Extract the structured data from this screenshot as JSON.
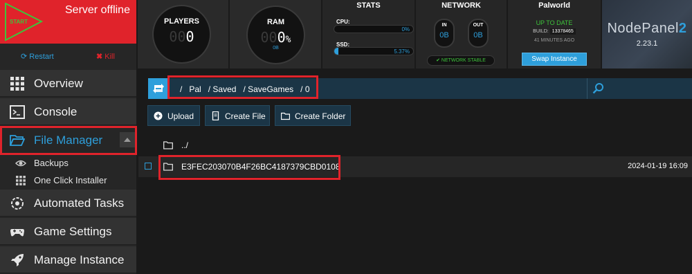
{
  "server": {
    "start_label": "START",
    "status": "Server offline",
    "restart_label": "Restart",
    "kill_label": "Kill"
  },
  "gauges": {
    "players": {
      "title": "PLAYERS",
      "dim": "00",
      "value": "0"
    },
    "ram": {
      "title": "RAM",
      "dim": "00",
      "value": "0",
      "unit": "%",
      "sub": "0B"
    }
  },
  "stats": {
    "title": "STATS",
    "cpu": {
      "label": "CPU:",
      "value": "0%",
      "fill_pct": 0
    },
    "ssd": {
      "label": "SSD:",
      "value": "5.37%",
      "fill_pct": 5.37
    }
  },
  "network": {
    "title": "NETWORK",
    "in_label": "IN",
    "in_value": "0B",
    "out_label": "OUT",
    "out_value": "0B",
    "status": "NETWORK STABLE"
  },
  "game": {
    "title": "Palworld",
    "status": "UP TO DATE",
    "build_label": "BUILD:",
    "build_number": "13378465",
    "build_age": "41 MINUTES AGO",
    "swap_label": "Swap Instance"
  },
  "brand": {
    "name_main": "NodePanel",
    "name_suffix": "2",
    "version": "2.23.1"
  },
  "sidebar": {
    "items": [
      {
        "label": "Overview",
        "icon": "grid-icon"
      },
      {
        "label": "Console",
        "icon": "terminal-icon"
      },
      {
        "label": "File Manager",
        "icon": "folder-open-icon",
        "active": true
      },
      {
        "label": "Automated Tasks",
        "icon": "gear-refresh-icon"
      },
      {
        "label": "Game Settings",
        "icon": "gamepad-icon"
      },
      {
        "label": "Manage Instance",
        "icon": "rocket-icon"
      }
    ],
    "subitems": [
      {
        "label": "Backups",
        "icon": "eye-refresh-icon"
      },
      {
        "label": "One Click Installer",
        "icon": "grid-icon"
      }
    ]
  },
  "file_manager": {
    "path": [
      "/",
      "Pal",
      "/ Saved",
      "/ SaveGames",
      "/ 0"
    ],
    "toolbar": {
      "upload": "Upload",
      "create_file": "Create File",
      "create_folder": "Create Folder"
    },
    "rows": [
      {
        "name": "../",
        "date": ""
      },
      {
        "name": "E3FEC203070B4F26BC4187379CBD0108",
        "date": "2024-01-19 16:09"
      }
    ]
  },
  "colors": {
    "accent": "#2e9fdb",
    "danger": "#e0232b",
    "success": "#3ec43b"
  }
}
